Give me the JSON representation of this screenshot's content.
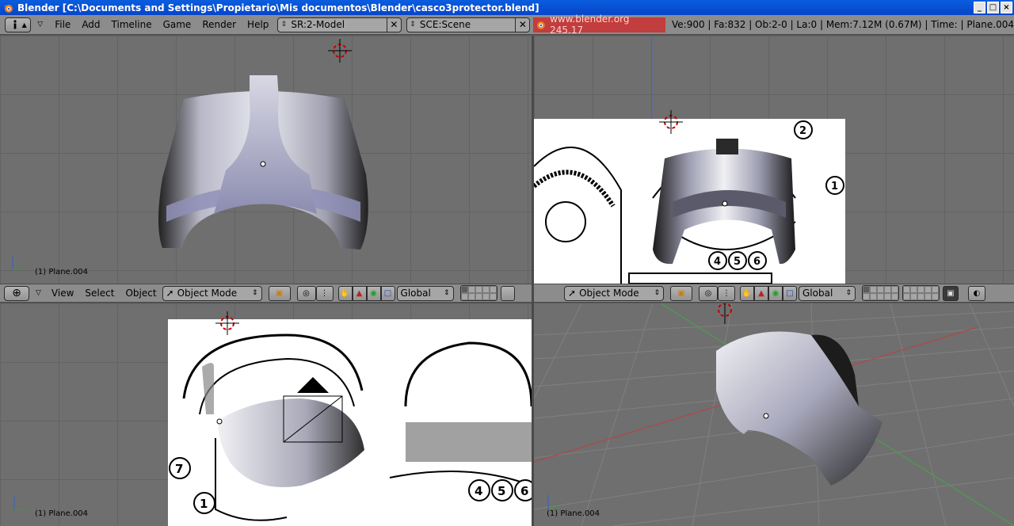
{
  "window": {
    "title": "Blender [C:\\Documents and Settings\\Propietario\\Mis documentos\\Blender\\casco3protector.blend]",
    "controls": [
      "_",
      "□",
      "×"
    ]
  },
  "menubar": {
    "menus": [
      "File",
      "Add",
      "Timeline",
      "Game",
      "Render",
      "Help"
    ],
    "screen_field": "SR:2-Model",
    "scene_field": "SCE:Scene",
    "website": "www.blender.org 245.17",
    "stats": "Ve:900 | Fa:832 | Ob:2-0 | La:0  | Mem:7.12M (0.67M)  | Time: | Plane.004"
  },
  "viewports": {
    "top_left": {
      "label": "(1) Plane.004"
    },
    "top_right": {
      "label": ""
    },
    "bottom_left": {
      "label": "(1) Plane.004"
    },
    "bottom_right": {
      "label": "(1) Plane.004"
    }
  },
  "header_left": {
    "menus": [
      "View",
      "Select",
      "Object"
    ],
    "mode": "Object Mode",
    "orientation": "Global"
  },
  "header_right": {
    "mode": "Object Mode",
    "orientation": "Global"
  },
  "reference_callouts": {
    "top_right": [
      "2",
      "1",
      "4",
      "5",
      "6"
    ],
    "bottom_left": [
      "7",
      "1",
      "4",
      "5",
      "6"
    ]
  },
  "icons": [
    "blender-logo-icon",
    "info-icon",
    "cursor-crosshair-icon",
    "hand-icon",
    "rotate-icon",
    "scale-icon",
    "lock-icon"
  ],
  "colors": {
    "titlebar": "#0645c9",
    "menubar": "#8c8c8c",
    "viewport_bg": "#6f6f6f",
    "grid_x": "#b04848",
    "grid_y": "#4aa048"
  }
}
